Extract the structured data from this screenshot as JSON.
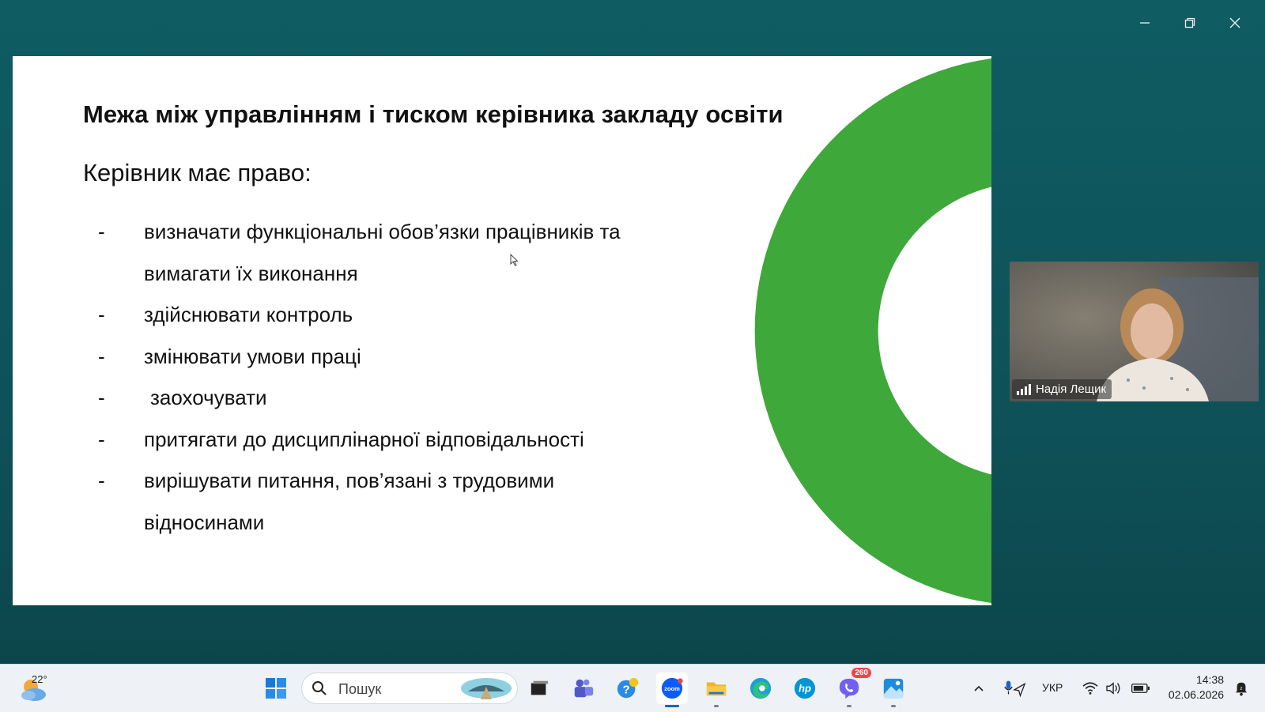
{
  "slide": {
    "title": "Межа між управлінням і тиском керівника закладу освіти",
    "subtitle": "Керівник має право:",
    "bullets": [
      {
        "dash": "-",
        "text": "визначати функціональні обов’язки працівників та"
      },
      {
        "dash": "",
        "text": "вимагати їх виконання"
      },
      {
        "dash": "-",
        "text": "здійснювати контроль"
      },
      {
        "dash": "-",
        "text": "змінювати умови праці"
      },
      {
        "dash": "-",
        "text": "заохочувати"
      },
      {
        "dash": "-",
        "text": "притягати до дисциплінарної відповідальності"
      },
      {
        "dash": "-",
        "text": "вирішувати питання, пов’язані з трудовими"
      },
      {
        "dash": "",
        "text": "відносинами"
      }
    ],
    "accent_color": "#3ea83a"
  },
  "participant": {
    "name": "Надія Лещик"
  },
  "taskbar": {
    "weather_temp": "22°",
    "search_placeholder": "Пошук",
    "viber_badge": "260",
    "language": "УКР",
    "time": "14:38",
    "date": "02.06.2026"
  },
  "icons": {
    "minimize": "minimize-icon",
    "restore": "restore-icon",
    "close": "close-icon"
  }
}
